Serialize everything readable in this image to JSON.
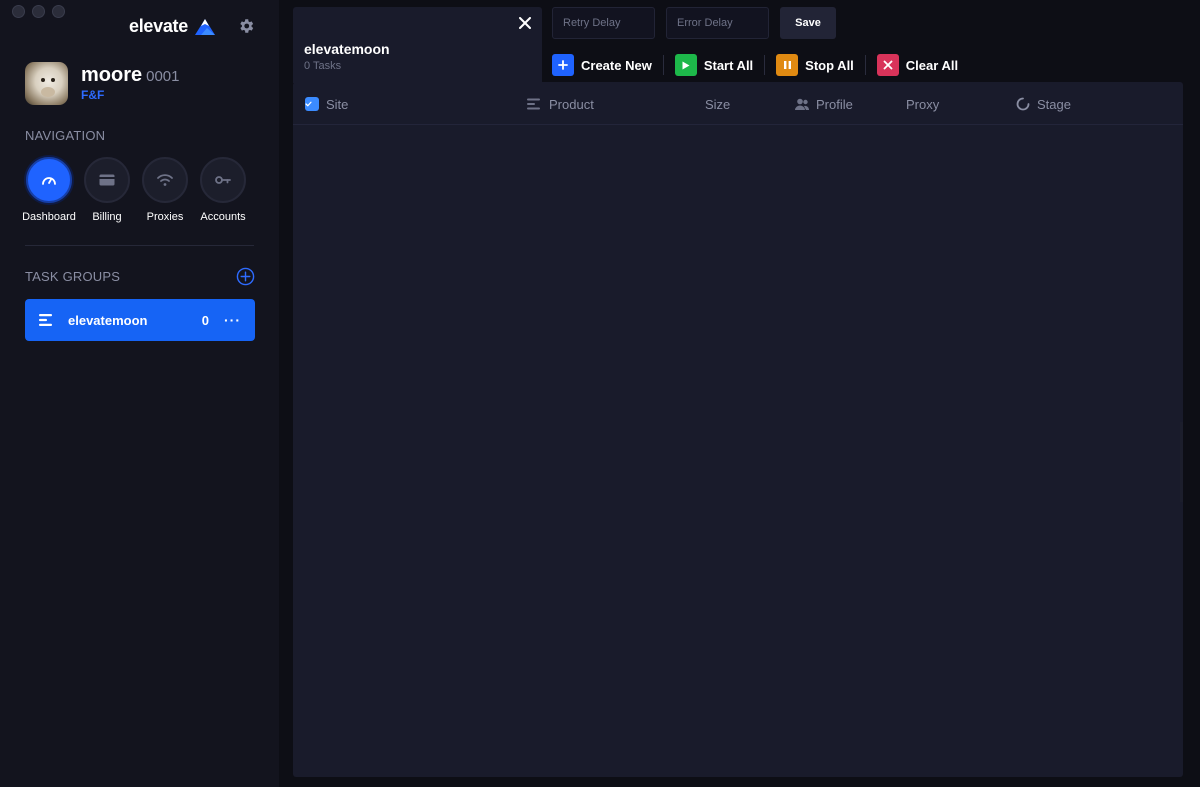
{
  "app": {
    "brand_name": "elevate",
    "accent_color": "#1f63ff"
  },
  "user": {
    "name": "moore",
    "tag": "0001",
    "role": "F&F"
  },
  "navigation": {
    "label": "NAVIGATION",
    "items": [
      {
        "label": "Dashboard",
        "icon": "gauge-icon",
        "active": true
      },
      {
        "label": "Billing",
        "icon": "card-icon",
        "active": false
      },
      {
        "label": "Proxies",
        "icon": "wifi-icon",
        "active": false
      },
      {
        "label": "Accounts",
        "icon": "key-icon",
        "active": false
      }
    ]
  },
  "task_groups": {
    "label": "TASK GROUPS",
    "items": [
      {
        "name": "elevatemoon",
        "count": "0",
        "more": "···"
      }
    ]
  },
  "tab": {
    "title": "elevatemoon",
    "subtitle": "0 Tasks"
  },
  "settings": {
    "retry_placeholder": "Retry Delay",
    "error_placeholder": "Error Delay",
    "save_label": "Save"
  },
  "actions": {
    "create_new": "Create New",
    "start_all": "Start All",
    "stop_all": "Stop All",
    "clear_all": "Clear All",
    "colors": {
      "create_new": "#1f63ff",
      "start_all": "#1db84a",
      "stop_all": "#e08a12",
      "clear_all": "#d8335a"
    }
  },
  "table": {
    "columns": [
      "Site",
      "Product",
      "Size",
      "Profile",
      "Proxy",
      "Stage"
    ],
    "rows": []
  }
}
